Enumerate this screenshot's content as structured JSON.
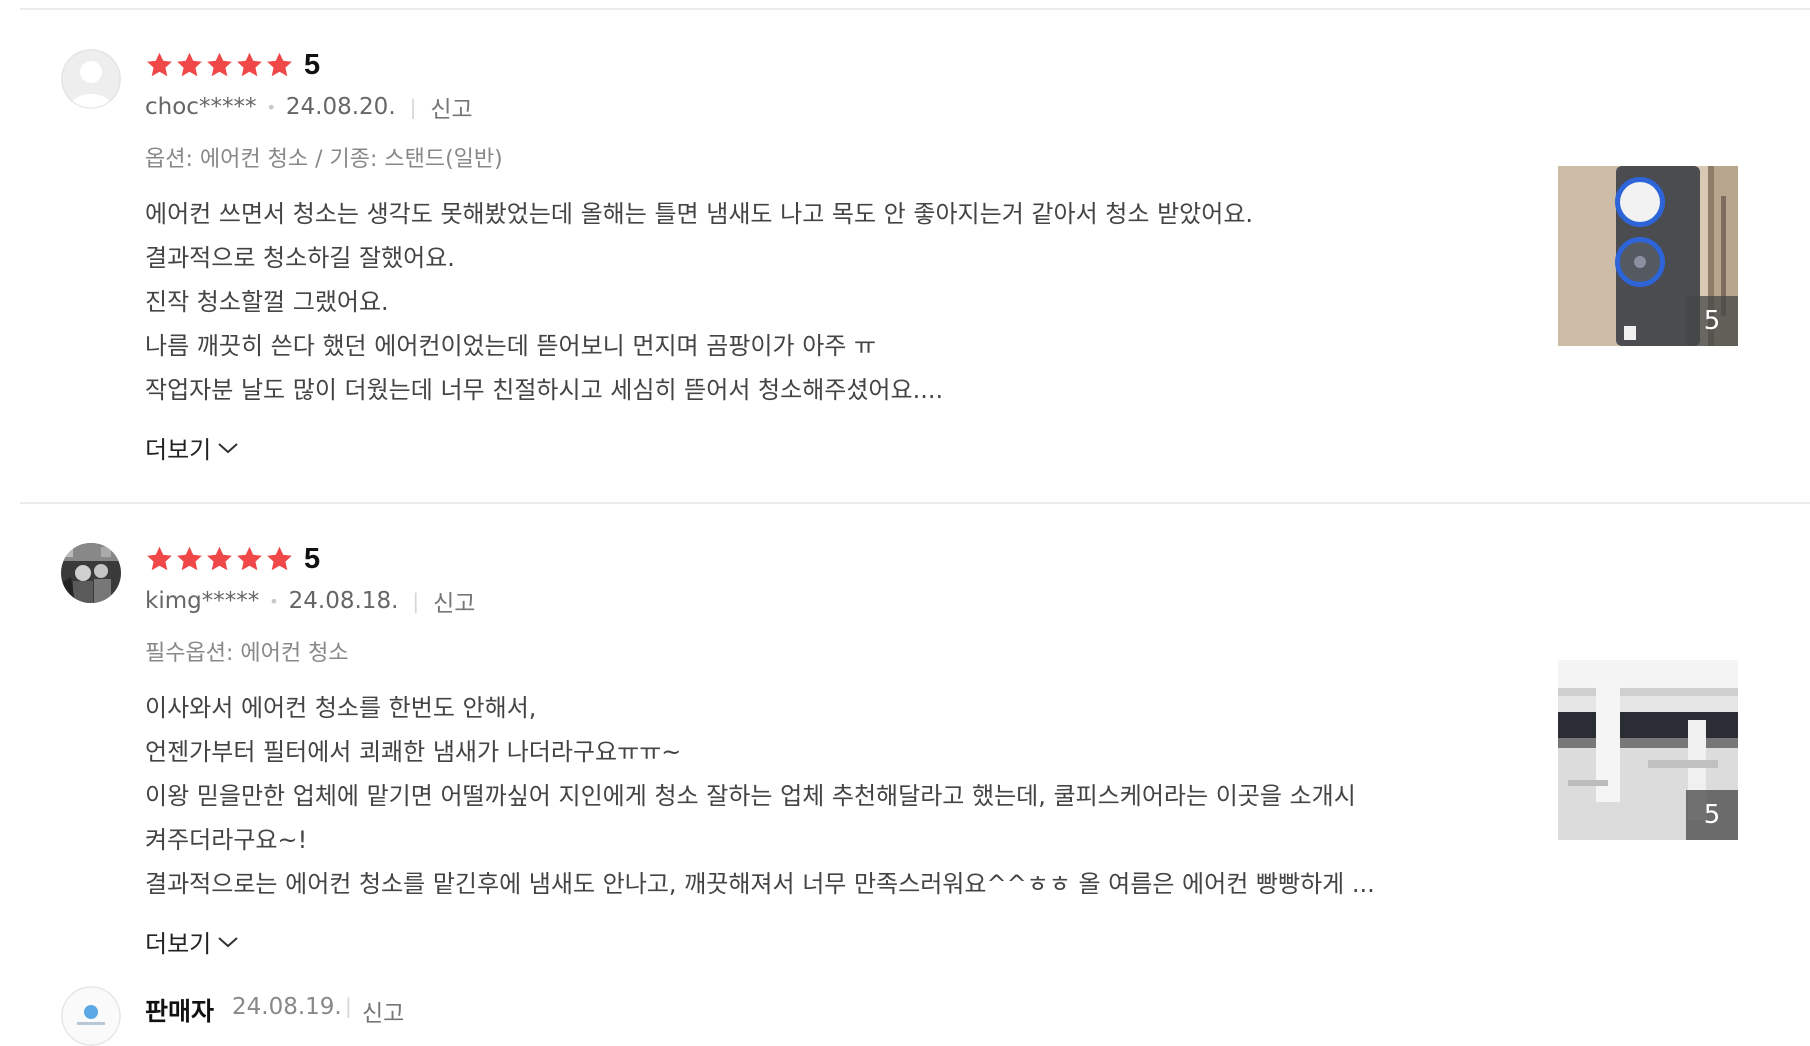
{
  "reviews": [
    {
      "rating": "5",
      "user": "choc*****",
      "date": "24.08.20.",
      "report": "신고",
      "option": "옵션: 에어컨 청소 / 기종: 스탠드(일반)",
      "lines": [
        "에어컨 쓰면서 청소는 생각도 못해봤었는데 올해는 틀면 냄새도 나고 목도 안 좋아지는거 같아서 청소 받았어요.",
        "결과적으로 청소하길 잘했어요.",
        "진작 청소할껄 그랬어요.",
        "나름 깨끗히 쓴다 했던 에어컨이었는데 뜯어보니 먼지며 곰팡이가 아주 ㅠ",
        "작업자분 날도 많이 더웠는데 너무 친절하시고 세심히 뜯어서 청소해주셨어요...."
      ],
      "more_label": "더보기",
      "photo_count": "5"
    },
    {
      "rating": "5",
      "user": "kimg*****",
      "date": "24.08.18.",
      "report": "신고",
      "option": "필수옵션: 에어컨 청소",
      "lines": [
        "이사와서 에어컨 청소를 한번도 안해서,",
        "언젠가부터 필터에서 쾨쾌한 냄새가 나더라구요ㅠㅠ~",
        "이왕 믿을만한 업체에 맡기면 어떨까싶어 지인에게 청소 잘하는 업체 추천해달라고 했는데, 쿨피스케어라는 이곳을 소개시",
        "켜주더라구요~!",
        "결과적으로는 에어컨 청소를 맡긴후에 냄새도 안나고, 깨끗해져서 너무 만족스러워요^^ㅎㅎ 올 여름은 에어컨 빵빵하게 ..."
      ],
      "more_label": "더보기",
      "photo_count": "5"
    }
  ],
  "seller_reply": {
    "name": "판매자",
    "date": "24.08.19.",
    "report": "신고"
  },
  "colors": {
    "star": "#f04848",
    "divider": "#ececec"
  }
}
